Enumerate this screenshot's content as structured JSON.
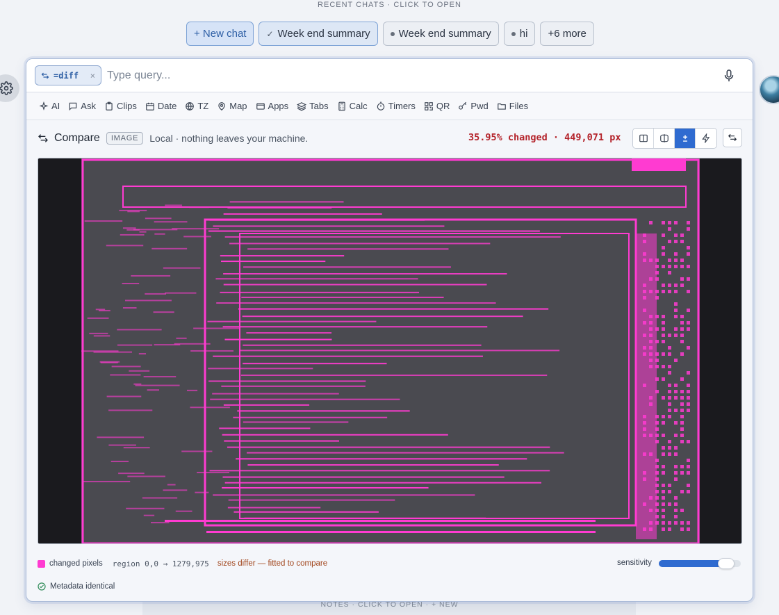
{
  "recent": {
    "label": "RECENT CHATS · CLICK TO OPEN",
    "chips": [
      {
        "label": "+ New chat",
        "kind": "new"
      },
      {
        "label": "Week end summary",
        "kind": "active",
        "icon": "check-icon"
      },
      {
        "label": "Week end summary",
        "kind": "normal",
        "icon": "dot-icon"
      },
      {
        "label": "hi",
        "kind": "normal",
        "icon": "dot-icon"
      },
      {
        "label": "+6 more",
        "kind": "more"
      }
    ]
  },
  "query": {
    "mode_label": "=diff",
    "mode_icon": "swap-icon",
    "placeholder": "Type query..."
  },
  "tools": [
    {
      "label": "AI",
      "icon": "sparkle-icon"
    },
    {
      "label": "Ask",
      "icon": "chat-bubble-icon"
    },
    {
      "label": "Clips",
      "icon": "clipboard-icon"
    },
    {
      "label": "Date",
      "icon": "calendar-icon"
    },
    {
      "label": "TZ",
      "icon": "globe-icon"
    },
    {
      "label": "Map",
      "icon": "map-pin-icon"
    },
    {
      "label": "Apps",
      "icon": "window-icon"
    },
    {
      "label": "Tabs",
      "icon": "layers-icon"
    },
    {
      "label": "Calc",
      "icon": "calculator-icon"
    },
    {
      "label": "Timers",
      "icon": "stopwatch-icon"
    },
    {
      "label": "QR",
      "icon": "qr-icon"
    },
    {
      "label": "Pwd",
      "icon": "key-icon"
    },
    {
      "label": "Files",
      "icon": "folder-icon"
    }
  ],
  "compare": {
    "title": "Compare",
    "badge": "IMAGE",
    "local_note": "Local · nothing leaves your machine.",
    "changed_stat": "35.95% changed · 449,071 px",
    "accent": "#2f6bd0",
    "diff_color": "#ff3bd1"
  },
  "legend": {
    "changed_label": "changed pixels",
    "region": "region 0,0 → 1279,975",
    "sizes_note": "sizes differ — fitted to compare",
    "sensitivity_label": "sensitivity",
    "sensitivity_level": 0.82
  },
  "meta": {
    "label": "Metadata identical"
  },
  "notes": {
    "label": "NOTES · CLICK TO OPEN · + NEW"
  }
}
